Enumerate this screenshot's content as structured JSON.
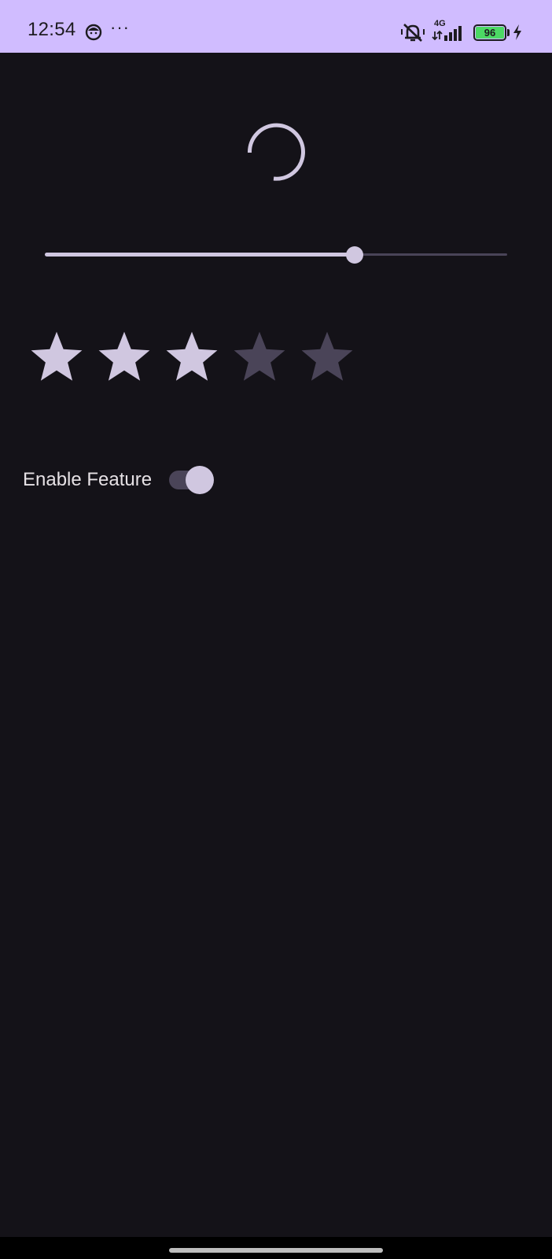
{
  "status_bar": {
    "time": "12:54",
    "dots": "···",
    "network": "4G",
    "battery": "96",
    "icons": [
      "face-notification-icon",
      "more-notifications-icon",
      "vibrate-off-icon",
      "signal-icon",
      "battery-icon",
      "charging-icon"
    ]
  },
  "content": {
    "spinner": {
      "icon": "loading-spinner"
    },
    "slider": {
      "value": 0.67
    },
    "rating": {
      "value": 3,
      "max": 5,
      "icon": "star-icon"
    },
    "toggle": {
      "label": "Enable Feature",
      "checked": true
    }
  },
  "colors": {
    "status_bar_bg": "#d0bcff",
    "background": "#141218",
    "accent": "#d0c7e0",
    "inactive": "#4a4458",
    "battery_fill": "#4cd964",
    "text": "#e6e1e5"
  }
}
